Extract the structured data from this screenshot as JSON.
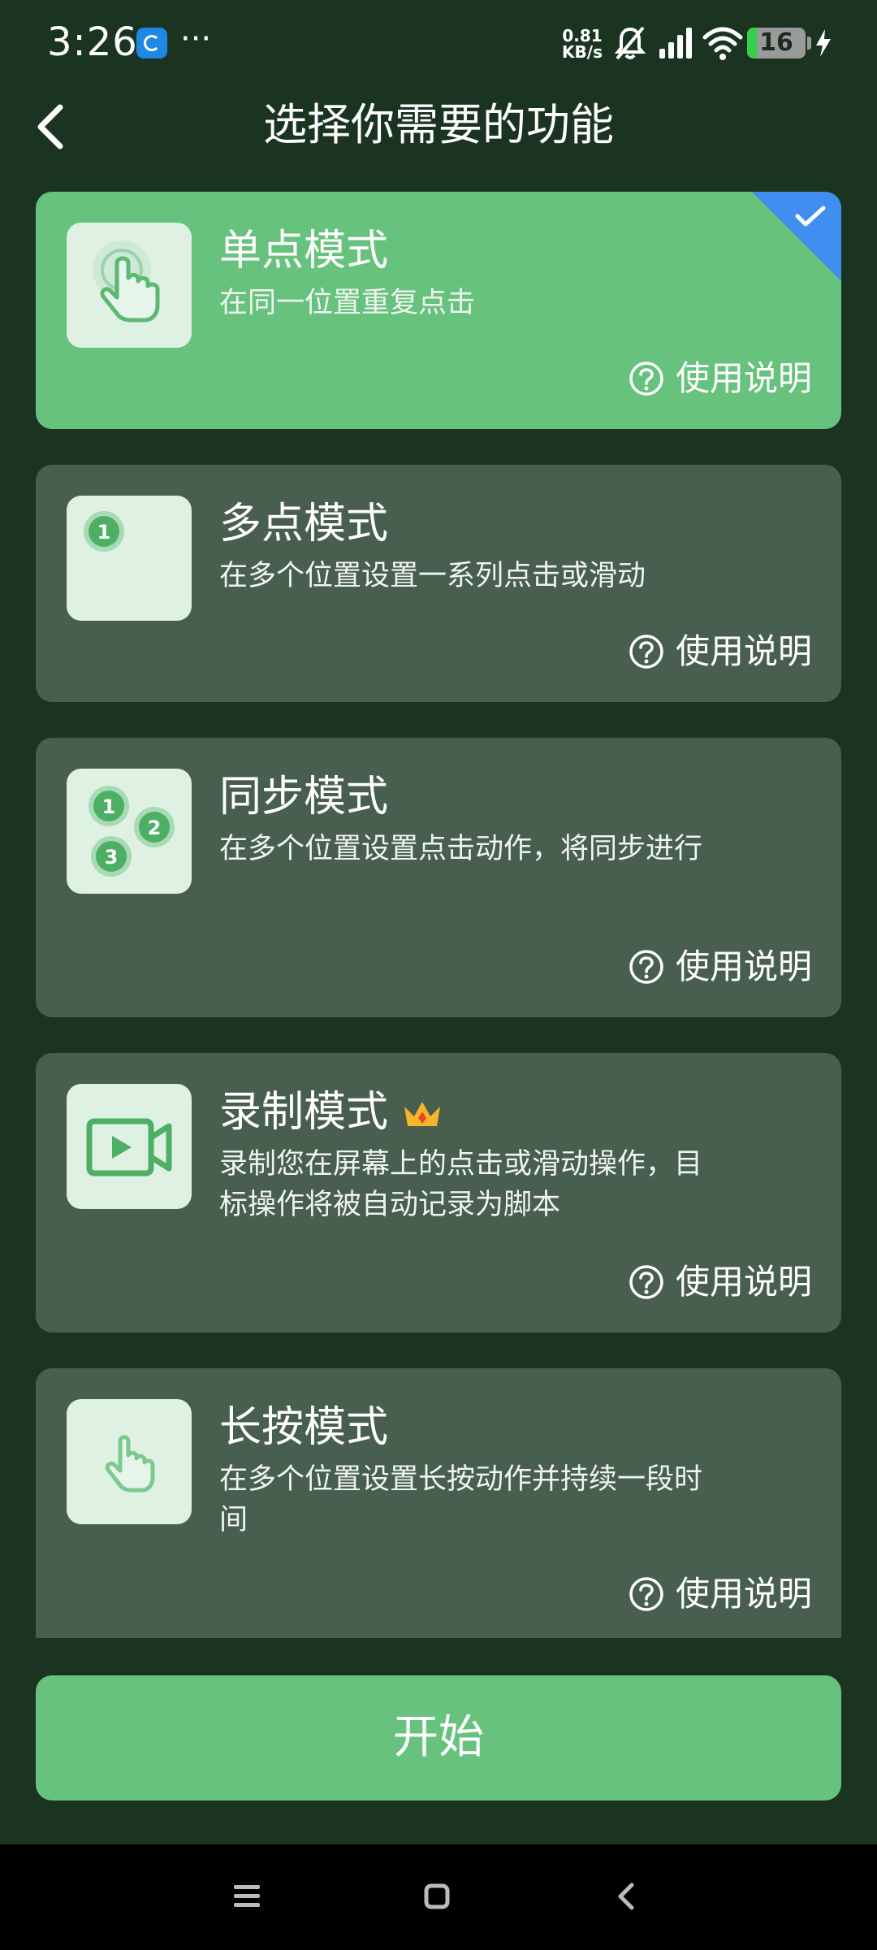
{
  "status_bar": {
    "time": "3:26",
    "more": "···",
    "speed_value": "0.81",
    "speed_unit": "KB/s",
    "battery_level": "16",
    "battery_fraction": 0.16
  },
  "header": {
    "title": "选择你需要的功能"
  },
  "modes": [
    {
      "title": "单点模式",
      "description": "在同一位置重复点击",
      "help": "使用说明",
      "icon": "tap-hand-icon",
      "selected": true
    },
    {
      "title": "多点模式",
      "description": "在多个位置设置一系列点击或滑动",
      "help": "使用说明",
      "icon": "multi-point-icon",
      "selected": false
    },
    {
      "title": "同步模式",
      "description": "在多个位置设置点击动作，将同步进行",
      "help": "使用说明",
      "icon": "sync-points-icon",
      "selected": false
    },
    {
      "title": "录制模式",
      "description": "录制您在屏幕上的点击或滑动操作，目标操作将被自动记录为脚本",
      "help": "使用说明",
      "icon": "video-record-icon",
      "badge": "crown-icon",
      "selected": false
    },
    {
      "title": "长按模式",
      "description": "在多个位置设置长按动作并持续一段时间",
      "help": "使用说明",
      "icon": "long-press-hand-icon",
      "selected": false
    }
  ],
  "marker_labels": {
    "one": "1",
    "two": "2",
    "three": "3"
  },
  "start_button": {
    "label": "开始"
  },
  "colors": {
    "background": "#1b3421",
    "card": "#485e4f",
    "accent_green": "#67c27d",
    "check_blue": "#3f8ef0",
    "icon_green": "#4caf64"
  }
}
